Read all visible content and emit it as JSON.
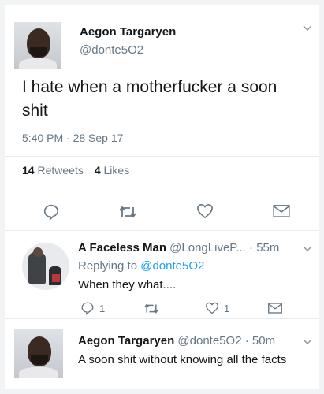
{
  "main_tweet": {
    "author_name": "Aegon Targaryen",
    "author_handle": "@donte5O2",
    "text": "I hate when a motherfucker a soon shit",
    "timestamp": "5:40 PM · 28 Sep 17",
    "retweets_count": "14",
    "retweets_label": "Retweets",
    "likes_count": "4",
    "likes_label": "Likes"
  },
  "reply_1": {
    "author_name": "A Faceless Man",
    "author_handle": "@LongLiveP...",
    "time": "· 55m",
    "replying_prefix": "Replying to",
    "replying_handle": "@donte5O2",
    "text": "When they what....",
    "reply_count": "1",
    "like_count": "1"
  },
  "reply_2": {
    "author_name": "Aegon Targaryen",
    "author_handle": "@donte5O2",
    "time": "· 50m",
    "text": "A soon shit without knowing all the facts"
  },
  "icons": {
    "reply": "reply-icon",
    "retweet": "retweet-icon",
    "like": "heart-icon",
    "message": "envelope-icon",
    "more": "chevron-down-icon"
  },
  "colors": {
    "text": "#14171a",
    "secondary": "#657786",
    "link": "#1da1f2"
  }
}
